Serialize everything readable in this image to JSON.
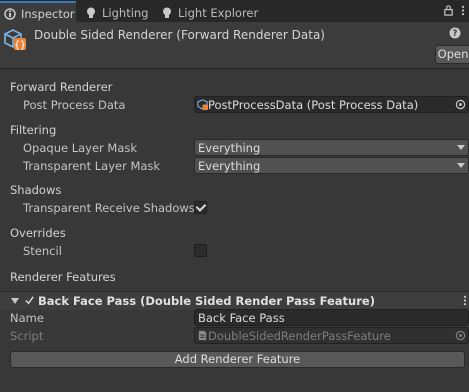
{
  "tabs": [
    {
      "label": "Inspector",
      "icon": "inspector-icon",
      "active": true
    },
    {
      "label": "Lighting",
      "icon": "lightbulb-icon",
      "active": false
    },
    {
      "label": "Light Explorer",
      "icon": "lightbulb-icon",
      "active": false
    }
  ],
  "header": {
    "title": "Double Sided Renderer (Forward Renderer Data)",
    "open_label": "Open"
  },
  "forward_renderer": {
    "heading": "Forward Renderer",
    "post_process_label": "Post Process Data",
    "post_process_value": "PostProcessData (Post Process Data)"
  },
  "filtering": {
    "heading": "Filtering",
    "opaque_label": "Opaque Layer Mask",
    "opaque_value": "Everything",
    "transparent_label": "Transparent Layer Mask",
    "transparent_value": "Everything"
  },
  "shadows": {
    "heading": "Shadows",
    "receive_label": "Transparent Receive Shadows",
    "receive_checked": true
  },
  "overrides": {
    "heading": "Overrides",
    "stencil_label": "Stencil",
    "stencil_checked": false
  },
  "renderer_features": {
    "heading": "Renderer Features",
    "feature_title": "Back Face Pass (Double Sided Render Pass Feature)",
    "name_label": "Name",
    "name_value": "Back Face Pass",
    "script_label": "Script",
    "script_value": "DoubleSidedRenderPassFeature",
    "add_label": "Add Renderer Feature"
  },
  "colors": {
    "accent": "#3a79bb",
    "panel_bg": "#383838",
    "tabbar_bg": "#282828"
  }
}
